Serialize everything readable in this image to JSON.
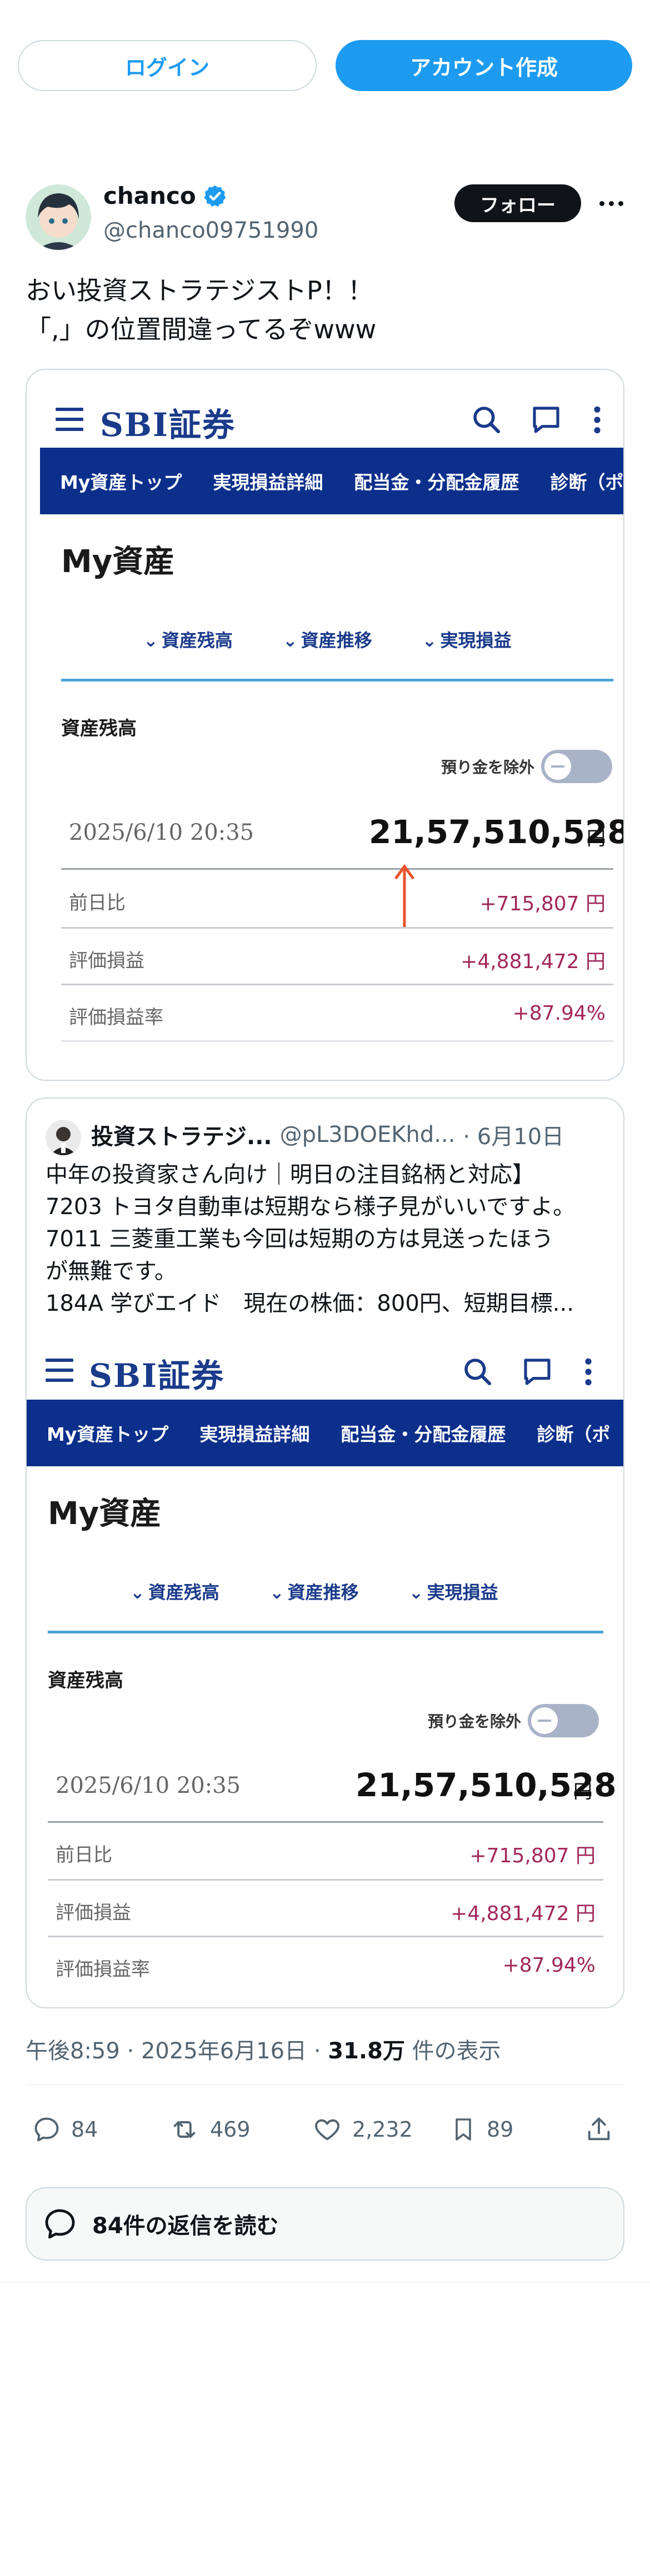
{
  "auth": {
    "login_label": "ログイン",
    "signup_label": "アカウント作成"
  },
  "tweet": {
    "author_name": "chanco",
    "author_handle": "@chanco09751990",
    "follow_label": "フォロー",
    "text": "おい投資ストラテジストP！！\n「,」の位置間違ってるぞwww",
    "timestamp": "午後8:59 · 2025年6月16日 · ",
    "views": "31.8万",
    "views_suffix": " 件の表示"
  },
  "sbi": {
    "logo": "SBI証券",
    "nav": [
      "My資産トップ",
      "実現損益詳細",
      "配当金・分配金履歴",
      "診断（ポ"
    ],
    "title": "My資産",
    "subtabs": [
      "資産残高",
      "資産推移",
      "実現損益"
    ],
    "section": "資産残高",
    "exclude_label": "預り金を除外",
    "date": "2025/6/10 20:35",
    "balance": "21,57,510,528",
    "yen": "円",
    "rows": [
      {
        "label": "前日比",
        "value": "+715,807 円"
      },
      {
        "label": "評価損益",
        "value": "+4,881,472 円"
      },
      {
        "label": "評価損益率",
        "value": "+87.94%"
      }
    ]
  },
  "quote": {
    "name": "投資ストラテジ...",
    "handle": "@pL3DOEKhd...",
    "date": "· 6月10日",
    "text": "中年の投資家さん向け｜明日の注目銘柄と対応】\n7203 トヨタ自動車は短期なら様子見がいいですよ。\n7011 三菱重工業も今回は短期の方は見送ったほう\nが無難です。\n184A 学びエイド　現在の株価：800円、短期目標..."
  },
  "actions": {
    "replies": "84",
    "reposts": "469",
    "likes": "2,232",
    "bookmarks": "89"
  },
  "read_replies_label": "84件の返信を読む",
  "colors": {
    "accent": "#1d9bf0",
    "sbi_navy": "#0c2f8c",
    "profit": "#a1275a",
    "arrow": "#e8532b"
  }
}
